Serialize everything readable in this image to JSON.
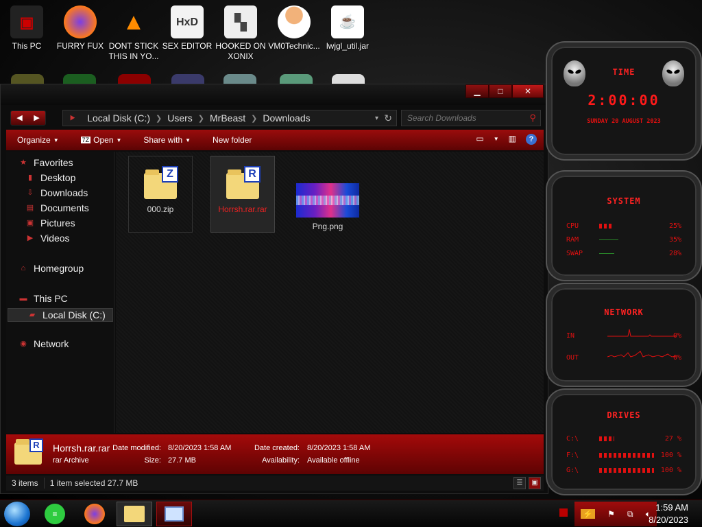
{
  "desktop": {
    "icons": [
      {
        "label": "This PC"
      },
      {
        "label": "FURRY FUX"
      },
      {
        "label": "DONT STICK THIS IN YO..."
      },
      {
        "label": "SEX EDITOR"
      },
      {
        "label": "HOOKED ON XONIX"
      },
      {
        "label": "VM0Technic..."
      },
      {
        "label": "lwjgl_util.jar"
      }
    ]
  },
  "window": {
    "controls": {
      "minimize": "▁",
      "maximize": "□",
      "close": "✕"
    },
    "nav": {
      "back": "◀",
      "forward": "▶"
    },
    "address": {
      "root_icon": "⯈",
      "segments": [
        "Local Disk (C:)",
        "Users",
        "MrBeast",
        "Downloads"
      ],
      "separator": "❯",
      "dropdown": "▾",
      "refresh": "↻"
    },
    "search": {
      "placeholder": "Search Downloads"
    },
    "toolbar": {
      "organize": "Organize",
      "open": "Open",
      "share_with": "Share with",
      "new_folder": "New folder"
    },
    "sidebar": {
      "favorites": "Favorites",
      "desktop": "Desktop",
      "downloads": "Downloads",
      "documents": "Documents",
      "pictures": "Pictures",
      "videos": "Videos",
      "homegroup": "Homegroup",
      "this_pc": "This PC",
      "local_disk": "Local Disk (C:)",
      "network": "Network"
    },
    "files": [
      {
        "name": "000.zip",
        "badge": "Z"
      },
      {
        "name": "Horrsh.rar.rar",
        "badge": "R"
      },
      {
        "name": "Png.png"
      }
    ],
    "details": {
      "name": "Horrsh.rar.rar",
      "type": "rar Archive",
      "badge": "R",
      "date_modified_label": "Date modified:",
      "date_modified": "8/20/2023 1:58 AM",
      "size_label": "Size:",
      "size": "27.7 MB",
      "date_created_label": "Date created:",
      "date_created": "8/20/2023 1:58 AM",
      "availability_label": "Availability:",
      "availability": "Available offline"
    },
    "status": {
      "items": "3 items",
      "selected": "1 item selected  27.7 MB"
    }
  },
  "gadgets": {
    "clock": {
      "title": "TIME",
      "time": "2:00:00",
      "date": "SUNDAY 20 AUGUST 2023"
    },
    "system": {
      "title": "SYSTEM",
      "rows": [
        {
          "label": "CPU",
          "pct": "25%",
          "level": 0.25
        },
        {
          "label": "RAM",
          "pct": "35%",
          "level": 0.35
        },
        {
          "label": "SWAP",
          "pct": "28%",
          "level": 0.28
        }
      ]
    },
    "network": {
      "title": "NETWORK",
      "rows": [
        {
          "label": "IN",
          "pct": "0%"
        },
        {
          "label": "OUT",
          "pct": "0%"
        }
      ]
    },
    "drives": {
      "title": "DRIVES",
      "rows": [
        {
          "label": "C:\\",
          "pct": "27 %",
          "level": 0.27
        },
        {
          "label": "F:\\",
          "pct": "100 %",
          "level": 1.0
        },
        {
          "label": "G:\\",
          "pct": "100 %",
          "level": 1.0
        }
      ]
    }
  },
  "taskbar": {
    "clock_time": "1:59 AM",
    "clock_date": "8/20/2023"
  },
  "colors": {
    "accent": "#a00c0c",
    "gadget_text": "#e01010"
  }
}
